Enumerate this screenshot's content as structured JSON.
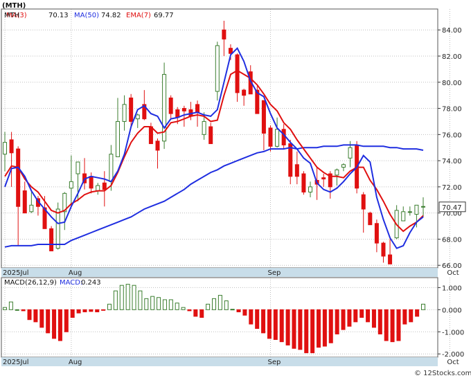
{
  "header": {
    "symbol_label": "(MTH)",
    "ma3_label": "MA(3)",
    "ma3_value": "70.13",
    "ma50_label": "MA(50)",
    "ma50_value": "74.82",
    "ema7_label": "EMA(7)",
    "ema7_value": "69.77",
    "macd_params": "MACD(26,12,9)",
    "macd_label": "MACD:",
    "macd_value": "0.243",
    "last_price_tag": "70.47",
    "watermark": "© 12Stocks.com"
  },
  "colors": {
    "up_candle": "#3a7d2e",
    "down_candle": "#e01010",
    "ma3": "#1f2ee0",
    "ma50": "#1f2ee0",
    "ema7": "#e01010",
    "macd_pos": "#3a7d2e",
    "macd_neg": "#e01010",
    "axis_band": "#c8dde9",
    "grid": "#bdbdbd"
  },
  "chart_data": [
    {
      "type": "candlestick",
      "title": "MTH",
      "x_tick_labels": [
        "2025Jul",
        "Aug",
        "Sep",
        "Oct"
      ],
      "x_tick_index": [
        0,
        10,
        40,
        67
      ],
      "y_ticks": [
        66,
        68,
        70,
        72,
        74,
        76,
        78,
        80,
        82,
        84
      ],
      "ylim": [
        65.8,
        85.6
      ],
      "grid": "on",
      "ohlc": [
        [
          74.5,
          76.2,
          73.2,
          75.4
        ],
        [
          75.6,
          76.2,
          72.0,
          74.6
        ],
        [
          74.9,
          75.1,
          67.5,
          70.5
        ],
        [
          71.7,
          72.4,
          70.0,
          70.0
        ],
        [
          70.1,
          71.6,
          70.0,
          70.6
        ],
        [
          71.1,
          71.3,
          69.8,
          70.5
        ],
        [
          70.4,
          71.3,
          68.9,
          68.8
        ],
        [
          68.8,
          69.0,
          67.1,
          67.1
        ],
        [
          67.3,
          70.8,
          67.2,
          70.3
        ],
        [
          70.1,
          71.6,
          68.7,
          71.5
        ],
        [
          71.9,
          74.4,
          70.5,
          72.4
        ],
        [
          73.0,
          73.1,
          70.9,
          73.9
        ],
        [
          73.0,
          74.2,
          71.8,
          72.3
        ],
        [
          72.8,
          73.1,
          71.5,
          71.9
        ],
        [
          71.7,
          72.3,
          71.4,
          72.1
        ],
        [
          72.3,
          73.2,
          70.5,
          71.8
        ],
        [
          72.4,
          75.2,
          71.7,
          74.5
        ],
        [
          74.3,
          78.8,
          74.3,
          77.0
        ],
        [
          77.0,
          79.0,
          76.3,
          78.3
        ],
        [
          78.8,
          79.1,
          76.6,
          77.0
        ],
        [
          77.2,
          77.6,
          76.5,
          77.5
        ],
        [
          78.3,
          79.4,
          77.1,
          77.2
        ],
        [
          76.6,
          76.9,
          75.8,
          75.3
        ],
        [
          75.5,
          75.7,
          73.4,
          74.8
        ],
        [
          75.5,
          81.5,
          74.9,
          80.6
        ],
        [
          78.8,
          79.0,
          77.2,
          77.6
        ],
        [
          77.9,
          78.1,
          76.8,
          77.3
        ],
        [
          78.0,
          78.2,
          76.6,
          77.8
        ],
        [
          77.9,
          78.5,
          77.1,
          77.4
        ],
        [
          78.3,
          78.6,
          76.6,
          77.7
        ],
        [
          76.0,
          77.7,
          75.6,
          77.0
        ],
        [
          76.6,
          76.9,
          75.8,
          75.3
        ],
        [
          79.3,
          83.1,
          78.6,
          82.8
        ],
        [
          84.0,
          84.7,
          82.0,
          83.3
        ],
        [
          82.6,
          82.9,
          81.7,
          82.2
        ],
        [
          82.1,
          82.2,
          78.5,
          79.2
        ],
        [
          79.4,
          79.5,
          78.2,
          79.0
        ],
        [
          80.8,
          81.3,
          79.3,
          79.1
        ],
        [
          79.4,
          79.7,
          77.6,
          77.6
        ],
        [
          78.6,
          78.6,
          74.8,
          76.1
        ],
        [
          76.5,
          76.7,
          74.7,
          75.1
        ],
        [
          75.1,
          77.3,
          75.0,
          76.4
        ],
        [
          76.4,
          76.8,
          74.9,
          75.2
        ],
        [
          75.3,
          75.6,
          72.2,
          72.8
        ],
        [
          73.7,
          74.7,
          72.2,
          72.8
        ],
        [
          73.0,
          73.2,
          71.4,
          71.6
        ],
        [
          71.6,
          72.4,
          71.2,
          72.0
        ],
        [
          72.5,
          73.5,
          71.0,
          72.2
        ],
        [
          72.7,
          73.0,
          72.0,
          72.6
        ],
        [
          73.0,
          73.2,
          71.1,
          72.0
        ],
        [
          72.9,
          73.4,
          72.1,
          73.3
        ],
        [
          73.5,
          73.8,
          73.2,
          73.7
        ],
        [
          74.2,
          75.5,
          73.5,
          75.0
        ],
        [
          75.2,
          75.5,
          71.5,
          71.9
        ],
        [
          71.4,
          71.6,
          68.5,
          70.3
        ],
        [
          70.0,
          70.1,
          69.2,
          69.1
        ],
        [
          69.2,
          69.5,
          67.0,
          67.7
        ],
        [
          67.7,
          67.8,
          66.2,
          66.7
        ],
        [
          66.8,
          68.2,
          66.1,
          66.1
        ],
        [
          68.1,
          70.6,
          68.0,
          70.2
        ],
        [
          69.4,
          70.5,
          69.8,
          70.1
        ],
        [
          70.1,
          70.5,
          69.8,
          70.1
        ],
        [
          69.9,
          70.4,
          68.9,
          70.6
        ],
        [
          70.5,
          71.2,
          69.7,
          70.5
        ]
      ],
      "ma3": [
        72.0,
        73.4,
        73.5,
        72.8,
        71.7,
        70.9,
        70.3,
        69.7,
        69.2,
        69.3,
        70.5,
        71.5,
        72.6,
        72.8,
        72.7,
        72.6,
        72.4,
        73.2,
        74.5,
        76.6,
        77.9,
        78.2,
        77.6,
        77.4,
        76.5,
        77.2,
        77.3,
        77.5,
        77.6,
        77.7,
        77.5,
        77.4,
        77.9,
        80.0,
        82.1,
        82.6,
        81.6,
        80.1,
        79.2,
        78.9,
        77.6,
        76.5,
        76.0,
        75.4,
        74.9,
        74.2,
        73.8,
        72.3,
        71.8,
        71.6,
        71.9,
        72.4,
        73.0,
        73.5,
        74.4,
        73.9,
        71.2,
        69.5,
        68.1,
        67.3,
        67.5,
        68.5,
        69.3,
        69.7
      ],
      "ema7": [
        72.8,
        73.6,
        73.5,
        72.6,
        72.0,
        71.6,
        70.9,
        70.2,
        70.0,
        70.2,
        70.7,
        71.0,
        71.4,
        71.6,
        71.7,
        71.7,
        72.1,
        73.1,
        74.3,
        75.4,
        76.1,
        76.6,
        76.6,
        76.1,
        76.2,
        76.9,
        77.0,
        77.2,
        77.4,
        77.5,
        77.4,
        77.0,
        77.1,
        79.0,
        80.6,
        80.9,
        80.6,
        80.3,
        79.8,
        79.1,
        78.3,
        77.8,
        76.9,
        76.4,
        75.6,
        74.9,
        74.2,
        73.5,
        73.1,
        72.8,
        72.8,
        72.7,
        73.2,
        73.5,
        73.5,
        72.5,
        71.8,
        70.9,
        69.9,
        69.1,
        68.6,
        69.0,
        69.3,
        69.8
      ],
      "ma50": [
        67.4,
        67.5,
        67.5,
        67.5,
        67.5,
        67.6,
        67.6,
        67.6,
        67.6,
        67.6,
        67.9,
        68.1,
        68.3,
        68.5,
        68.7,
        68.9,
        69.1,
        69.3,
        69.5,
        69.7,
        70.0,
        70.3,
        70.5,
        70.7,
        70.9,
        71.2,
        71.5,
        71.8,
        72.2,
        72.5,
        72.8,
        73.1,
        73.3,
        73.6,
        73.8,
        74.0,
        74.2,
        74.4,
        74.6,
        74.7,
        74.9,
        74.9,
        74.9,
        75.0,
        74.9,
        75.0,
        75.0,
        75.0,
        75.1,
        75.1,
        75.1,
        75.2,
        75.2,
        75.2,
        75.1,
        75.1,
        75.1,
        75.1,
        75.0,
        75.0,
        74.9,
        74.9,
        74.9,
        74.8
      ]
    },
    {
      "type": "bar",
      "title": "MACD(26,12,9)",
      "y_ticks": [
        1.0,
        0.0,
        -1.0,
        -2.0
      ],
      "y_tick_labels": [
        "1.000",
        "0.000",
        "-1.000",
        "-2.000"
      ],
      "ylim": [
        -2.15,
        1.45
      ],
      "x_tick_labels": [
        "2025Jul",
        "Aug",
        "Sep",
        "Oct"
      ],
      "values": [
        0.1,
        0.35,
        0.0,
        -0.05,
        -0.45,
        -0.55,
        -0.8,
        -1.05,
        -1.3,
        -1.4,
        -1.0,
        -0.35,
        -0.15,
        -0.1,
        -0.08,
        -0.1,
        -0.02,
        0.25,
        0.85,
        1.1,
        1.15,
        1.1,
        0.85,
        0.5,
        0.6,
        0.55,
        0.45,
        0.45,
        0.3,
        0.1,
        -0.05,
        -0.3,
        -0.35,
        0.25,
        0.5,
        0.65,
        0.4,
        0.02,
        -0.1,
        -0.25,
        -0.65,
        -0.85,
        -1.05,
        -1.3,
        -1.35,
        -1.45,
        -1.6,
        -1.75,
        -1.8,
        -1.95,
        -1.95,
        -1.7,
        -1.65,
        -1.5,
        -1.1,
        -0.9,
        -0.75,
        -0.55,
        -0.35,
        -0.55,
        -0.8,
        -1.1,
        -1.4,
        -1.45,
        -1.4,
        -0.65,
        -0.55,
        -0.3,
        0.25
      ]
    }
  ]
}
